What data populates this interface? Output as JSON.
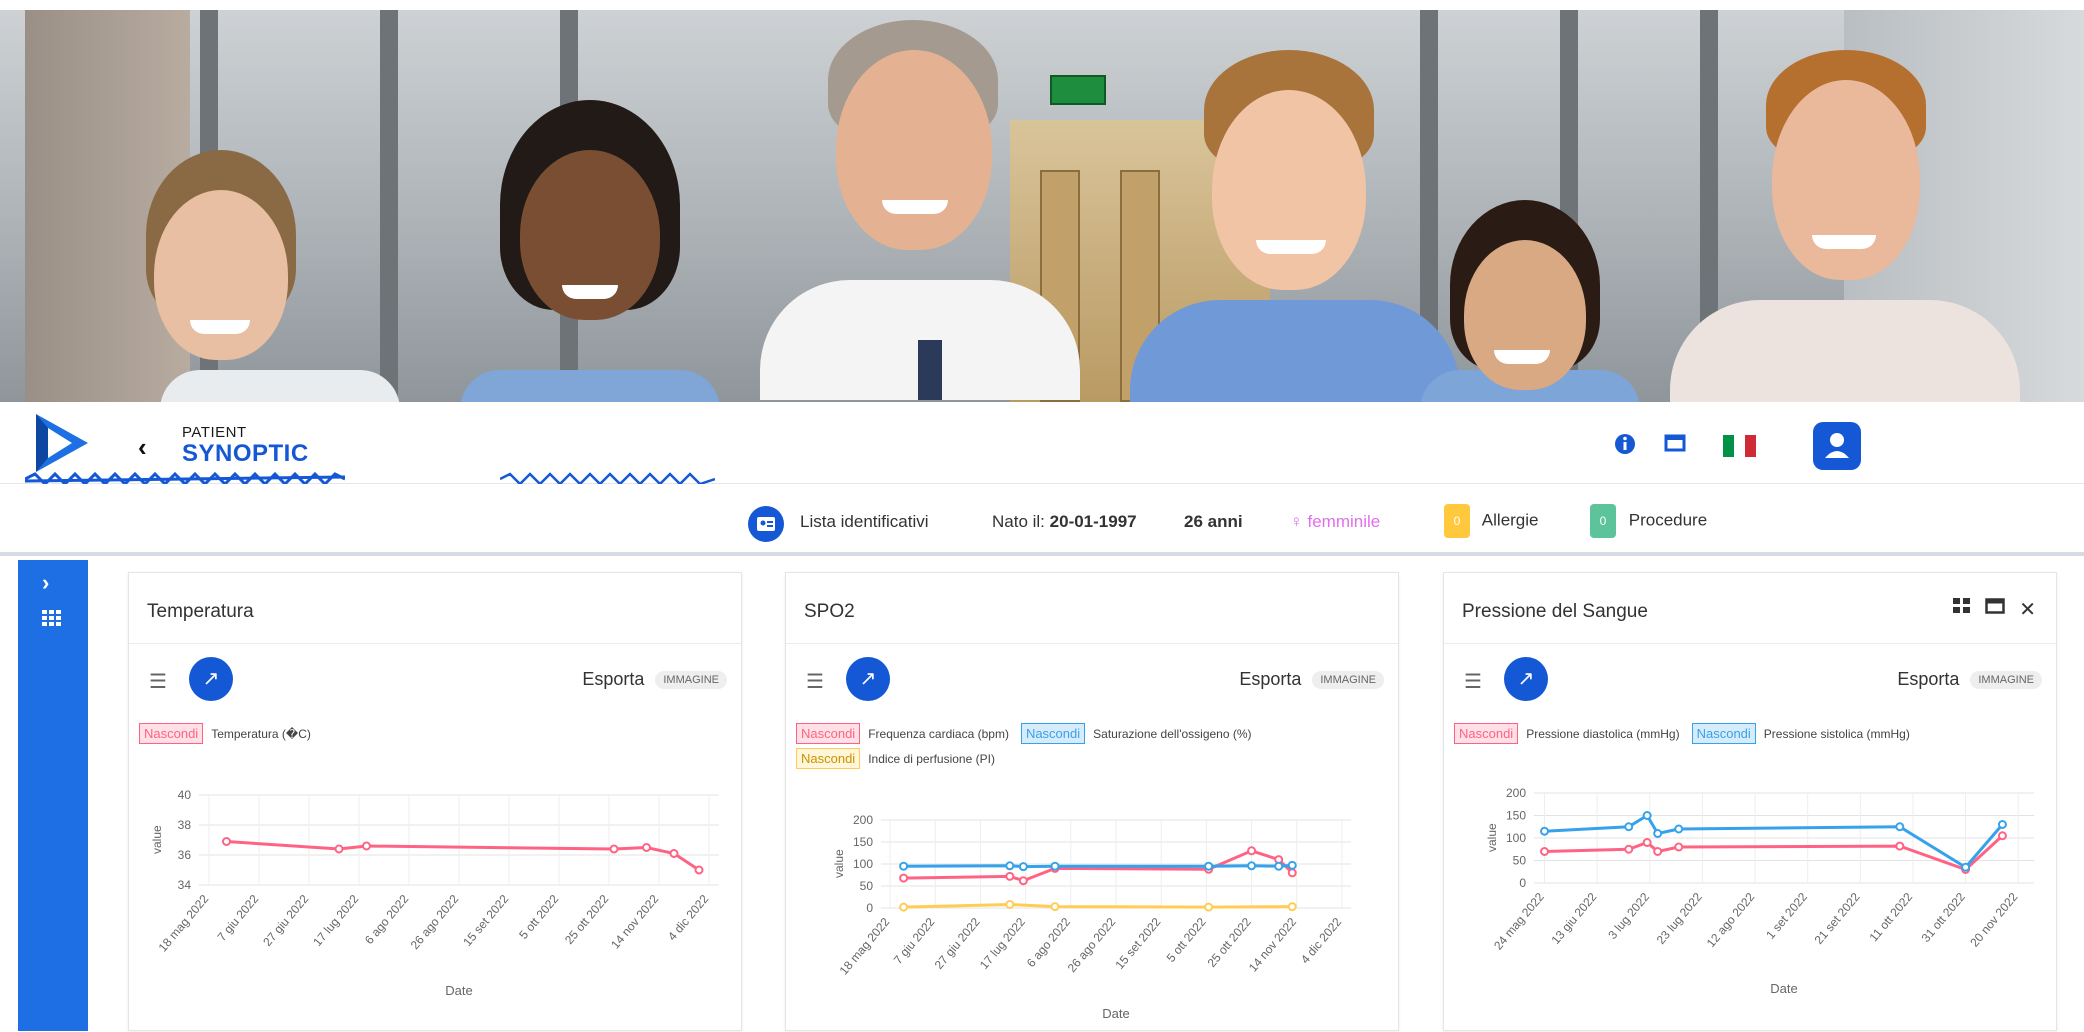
{
  "header": {
    "brand_top": "PATIENT",
    "brand_main": "SYNOPTIC"
  },
  "patient": {
    "ids_label": "Lista identificativi",
    "born_label": "Nato il:",
    "born_date": "20-01-1997",
    "age": "26 anni",
    "gender": "femminile",
    "allergies_count": "0",
    "allergies_label": "Allergie",
    "procedures_count": "0",
    "procedures_label": "Procedure"
  },
  "colors": {
    "accent": "#1558d6",
    "red": "#ff6384",
    "blue": "#36a2eb",
    "yellow": "#ffcd56",
    "flag_green": "#009246",
    "flag_red": "#ce2b37"
  },
  "cards": [
    {
      "title": "Temperatura",
      "export_label": "Esporta",
      "export_button": "IMMAGINE",
      "legend": [
        {
          "tag": "Nascondi",
          "label": "Temperatura (�C)",
          "color": "red"
        }
      ]
    },
    {
      "title": "SPO2",
      "export_label": "Esporta",
      "export_button": "IMMAGINE",
      "legend": [
        {
          "tag": "Nascondi",
          "label": "Frequenza cardiaca (bpm)",
          "color": "red"
        },
        {
          "tag": "Nascondi",
          "label": "Saturazione dell'ossigeno (%)",
          "color": "blue"
        },
        {
          "tag": "Nascondi",
          "label": "Indice di perfusione (PI)",
          "color": "yellow"
        }
      ]
    },
    {
      "title": "Pressione del Sangue",
      "export_label": "Esporta",
      "export_button": "IMMAGINE",
      "legend": [
        {
          "tag": "Nascondi",
          "label": "Pressione diastolica (mmHg)",
          "color": "red"
        },
        {
          "tag": "Nascondi",
          "label": "Pressione sistolica (mmHg)",
          "color": "blue"
        }
      ]
    }
  ],
  "chart_data": [
    {
      "type": "line",
      "ylabel": "value",
      "xlabel": "Date",
      "ylim": [
        34,
        40
      ],
      "yticks": [
        34,
        36,
        38,
        40
      ],
      "xtick_labels": [
        "18 mag 2022",
        "7 giu 2022",
        "27 giu 2022",
        "17 lug 2022",
        "6 ago 2022",
        "26 ago 2022",
        "15 set 2022",
        "5 ott 2022",
        "25 ott 2022",
        "14 nov 2022",
        "4 dic 2022"
      ],
      "series": [
        {
          "name": "Temperatura (�C)",
          "color": "red",
          "x": [
            "2022-05-25",
            "2022-07-09",
            "2022-07-20",
            "2022-10-27",
            "2022-11-09",
            "2022-11-20",
            "2022-11-30"
          ],
          "y": [
            36.9,
            36.4,
            36.6,
            36.4,
            36.5,
            36.1,
            35.0
          ]
        }
      ]
    },
    {
      "type": "line",
      "ylabel": "value",
      "xlabel": "Date",
      "ylim": [
        0,
        200
      ],
      "yticks": [
        0,
        50,
        100,
        150,
        200
      ],
      "xtick_labels": [
        "18 mag 2022",
        "7 giu 2022",
        "27 giu 2022",
        "17 lug 2022",
        "6 ago 2022",
        "26 ago 2022",
        "15 set 2022",
        "5 ott 2022",
        "25 ott 2022",
        "14 nov 2022",
        "4 dic 2022"
      ],
      "series": [
        {
          "name": "Frequenza cardiaca (bpm)",
          "color": "red",
          "x": [
            "2022-05-24",
            "2022-07-10",
            "2022-07-16",
            "2022-07-30",
            "2022-10-06",
            "2022-10-25",
            "2022-11-06",
            "2022-11-12"
          ],
          "y": [
            68,
            72,
            62,
            90,
            88,
            130,
            110,
            80
          ]
        },
        {
          "name": "Saturazione dell'ossigeno (%)",
          "color": "blue",
          "x": [
            "2022-05-24",
            "2022-07-10",
            "2022-07-16",
            "2022-07-30",
            "2022-10-06",
            "2022-10-25",
            "2022-11-06",
            "2022-11-12"
          ],
          "y": [
            95,
            96,
            94,
            95,
            95,
            96,
            95,
            97
          ]
        },
        {
          "name": "Indice di perfusione (PI)",
          "color": "yellow",
          "x": [
            "2022-05-24",
            "2022-07-10",
            "2022-07-30",
            "2022-10-06",
            "2022-11-12"
          ],
          "y": [
            2,
            8,
            3,
            2,
            3
          ]
        }
      ]
    },
    {
      "type": "line",
      "ylabel": "value",
      "xlabel": "Date",
      "ylim": [
        0,
        200
      ],
      "yticks": [
        0,
        50,
        100,
        150,
        200
      ],
      "xtick_labels": [
        "24 mag 2022",
        "13 giu 2022",
        "3 lug 2022",
        "23 lug 2022",
        "12 ago 2022",
        "1 set 2022",
        "21 set 2022",
        "11 ott 2022",
        "31 ott 2022",
        "20 nov 2022"
      ],
      "series": [
        {
          "name": "Pressione diastolica (mmHg)",
          "color": "red",
          "x": [
            "2022-05-24",
            "2022-06-25",
            "2022-07-02",
            "2022-07-06",
            "2022-07-14",
            "2022-10-06",
            "2022-10-31",
            "2022-11-14"
          ],
          "y": [
            70,
            75,
            90,
            70,
            80,
            82,
            30,
            105
          ]
        },
        {
          "name": "Pressione sistolica (mmHg)",
          "color": "blue",
          "x": [
            "2022-05-24",
            "2022-06-25",
            "2022-07-02",
            "2022-07-06",
            "2022-07-14",
            "2022-10-06",
            "2022-10-31",
            "2022-11-14"
          ],
          "y": [
            115,
            125,
            150,
            110,
            120,
            125,
            35,
            130
          ]
        }
      ]
    }
  ]
}
